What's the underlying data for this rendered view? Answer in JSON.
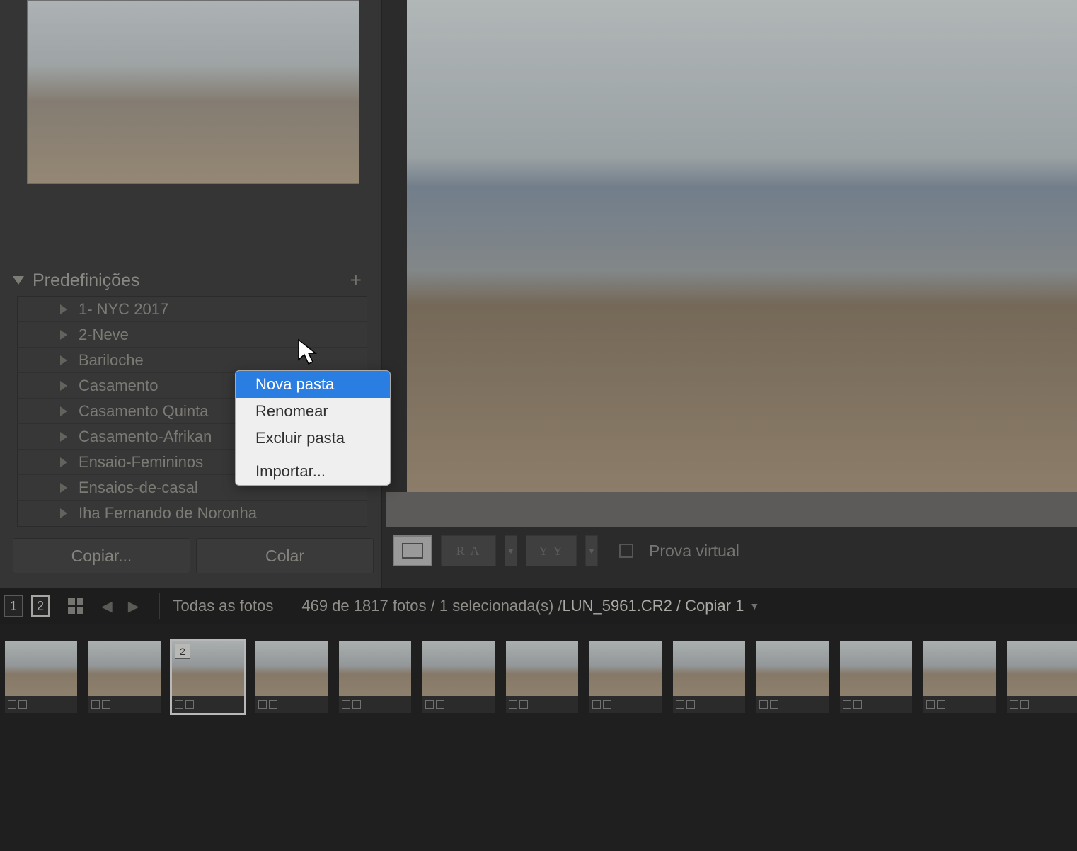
{
  "presets": {
    "header": "Predefinições",
    "items": [
      "1- NYC 2017",
      "2-Neve",
      "Bariloche",
      "Casamento",
      "Casamento Quinta",
      "Casamento-Afrikan",
      "Ensaio-Femininos",
      "Ensaios-de-casal",
      "Iha Fernando de Noronha"
    ]
  },
  "buttons": {
    "copy": "Copiar...",
    "paste": "Colar"
  },
  "context_menu": {
    "new_folder": "Nova pasta",
    "rename": "Renomear",
    "delete_folder": "Excluir pasta",
    "import": "Importar..."
  },
  "toolbar": {
    "compare_ra": "R A",
    "compare_yy": "Y Y",
    "soft_proof": "Prova virtual"
  },
  "info_bar": {
    "page1": "1",
    "page2": "2",
    "source_label": "Todas as fotos",
    "count_text": "469 de 1817 fotos / 1 selecionada(s) / ",
    "file_text": "LUN_5961.CR2 / Copiar 1"
  },
  "filmstrip": {
    "selected_badge": "2"
  }
}
